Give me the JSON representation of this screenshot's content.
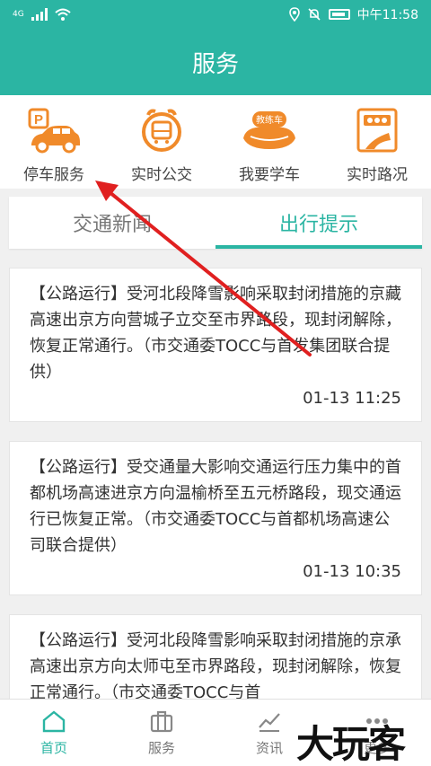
{
  "status_bar": {
    "network_label": "4G",
    "time": "中午11:58"
  },
  "header": {
    "title": "服务"
  },
  "services": [
    {
      "label": "停车服务",
      "icon": "parking-car-icon",
      "badge": "P"
    },
    {
      "label": "实时公交",
      "icon": "bus-clock-icon"
    },
    {
      "label": "我要学车",
      "icon": "driving-school-icon",
      "badge": "教练车"
    },
    {
      "label": "实时路况",
      "icon": "traffic-light-road-icon"
    }
  ],
  "tabs": [
    {
      "label": "交通新闻",
      "active": false
    },
    {
      "label": "出行提示",
      "active": true
    }
  ],
  "cards": [
    {
      "text": "【公路运行】受河北段降雪影响采取封闭措施的京藏高速出京方向营城子立交至市界路段，现封闭解除，恢复正常通行。（市交通委TOCC与首发集团联合提供）",
      "time": "01-13 11:25"
    },
    {
      "text": "【公路运行】受交通量大影响交通运行压力集中的首都机场高速进京方向温榆桥至五元桥路段，现交通运行已恢复正常。（市交通委TOCC与首都机场高速公司联合提供）",
      "time": "01-13 10:35"
    },
    {
      "text": "【公路运行】受河北段降雪影响采取封闭措施的京承高速出京方向太师屯至市界路段，现封闭解除，恢复正常通行。（市交通委TOCC与首",
      "time": ""
    }
  ],
  "tab_bar": [
    {
      "label": "首页",
      "icon": "home-icon",
      "active": true
    },
    {
      "label": "服务",
      "icon": "briefcase-icon",
      "active": false
    },
    {
      "label": "资讯",
      "icon": "chart-icon",
      "active": false
    },
    {
      "label": "更多",
      "icon": "more-icon",
      "active": false
    }
  ],
  "watermark": "大玩客",
  "colors": {
    "primary": "#2bb5a3",
    "icon_orange": "#f08a2a",
    "arrow_red": "#e02020"
  }
}
